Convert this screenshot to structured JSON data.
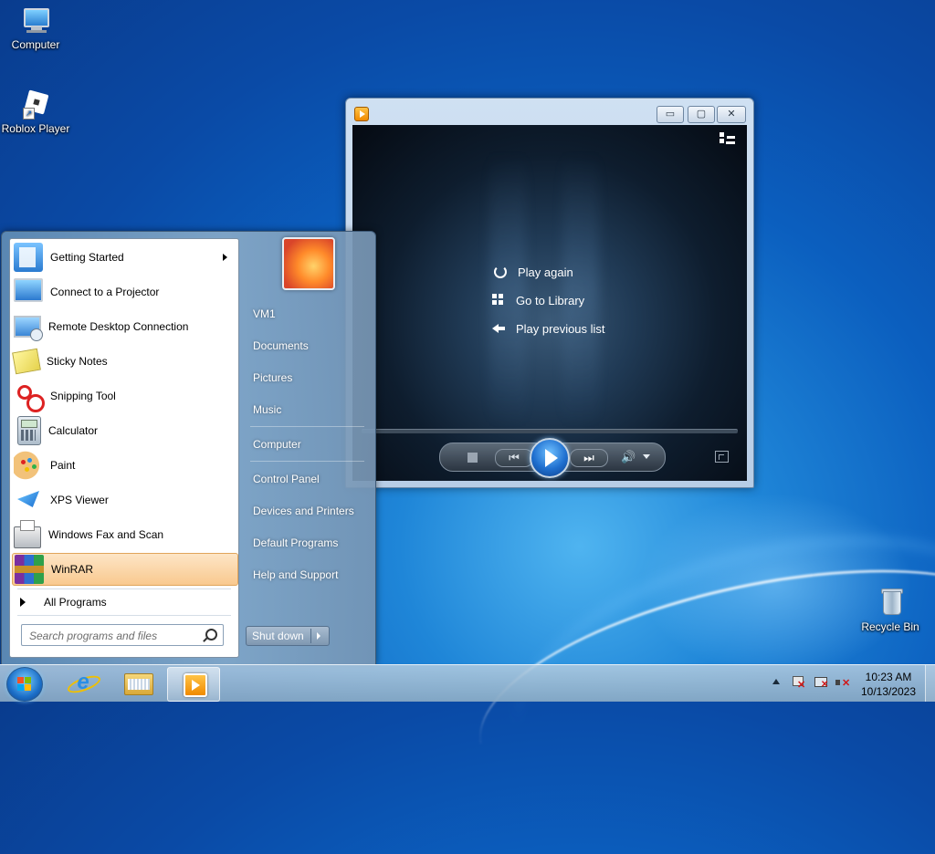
{
  "desktop": {
    "icons": [
      {
        "label": "Computer"
      },
      {
        "label": "Roblox Player"
      },
      {
        "label": "Recycle Bin"
      }
    ]
  },
  "media_player": {
    "options": [
      {
        "label": "Play again",
        "icon": "replay-icon"
      },
      {
        "label": "Go to Library",
        "icon": "library-icon"
      },
      {
        "label": "Play previous list",
        "icon": "back-arrow-icon"
      }
    ],
    "caption_buttons": {
      "minimize": "▭",
      "maximize": "▢",
      "close": "✕"
    }
  },
  "start_menu": {
    "programs": [
      {
        "label": "Getting Started",
        "icon": "getting-started-icon",
        "has_submenu": true
      },
      {
        "label": "Connect to a Projector",
        "icon": "projector-icon"
      },
      {
        "label": "Remote Desktop Connection",
        "icon": "remote-desktop-icon"
      },
      {
        "label": "Sticky Notes",
        "icon": "sticky-notes-icon"
      },
      {
        "label": "Snipping Tool",
        "icon": "scissors-icon"
      },
      {
        "label": "Calculator",
        "icon": "calculator-icon"
      },
      {
        "label": "Paint",
        "icon": "paint-palette-icon"
      },
      {
        "label": "XPS Viewer",
        "icon": "xps-viewer-icon"
      },
      {
        "label": "Windows Fax and Scan",
        "icon": "fax-icon"
      },
      {
        "label": "WinRAR",
        "icon": "winrar-icon",
        "selected": true
      }
    ],
    "all_programs": "All Programs",
    "search_placeholder": "Search programs and files",
    "right_links": [
      {
        "label": "VM1"
      },
      {
        "label": "Documents"
      },
      {
        "label": "Pictures"
      },
      {
        "label": "Music"
      },
      {
        "label": "Computer"
      },
      {
        "label": "Control Panel"
      },
      {
        "label": "Devices and Printers"
      },
      {
        "label": "Default Programs"
      },
      {
        "label": "Help and Support"
      }
    ],
    "shutdown_label": "Shut down"
  },
  "taskbar": {
    "pinned": [
      {
        "name": "internet-explorer"
      },
      {
        "name": "windows-explorer"
      },
      {
        "name": "windows-media-player",
        "active": true
      }
    ],
    "clock": {
      "time": "10:23 AM",
      "date": "10/13/2023"
    }
  },
  "colors": {
    "desktop_blue": "#0b5fbf",
    "selected_item": "#f9c98f",
    "media_accent": "#f08a00"
  }
}
